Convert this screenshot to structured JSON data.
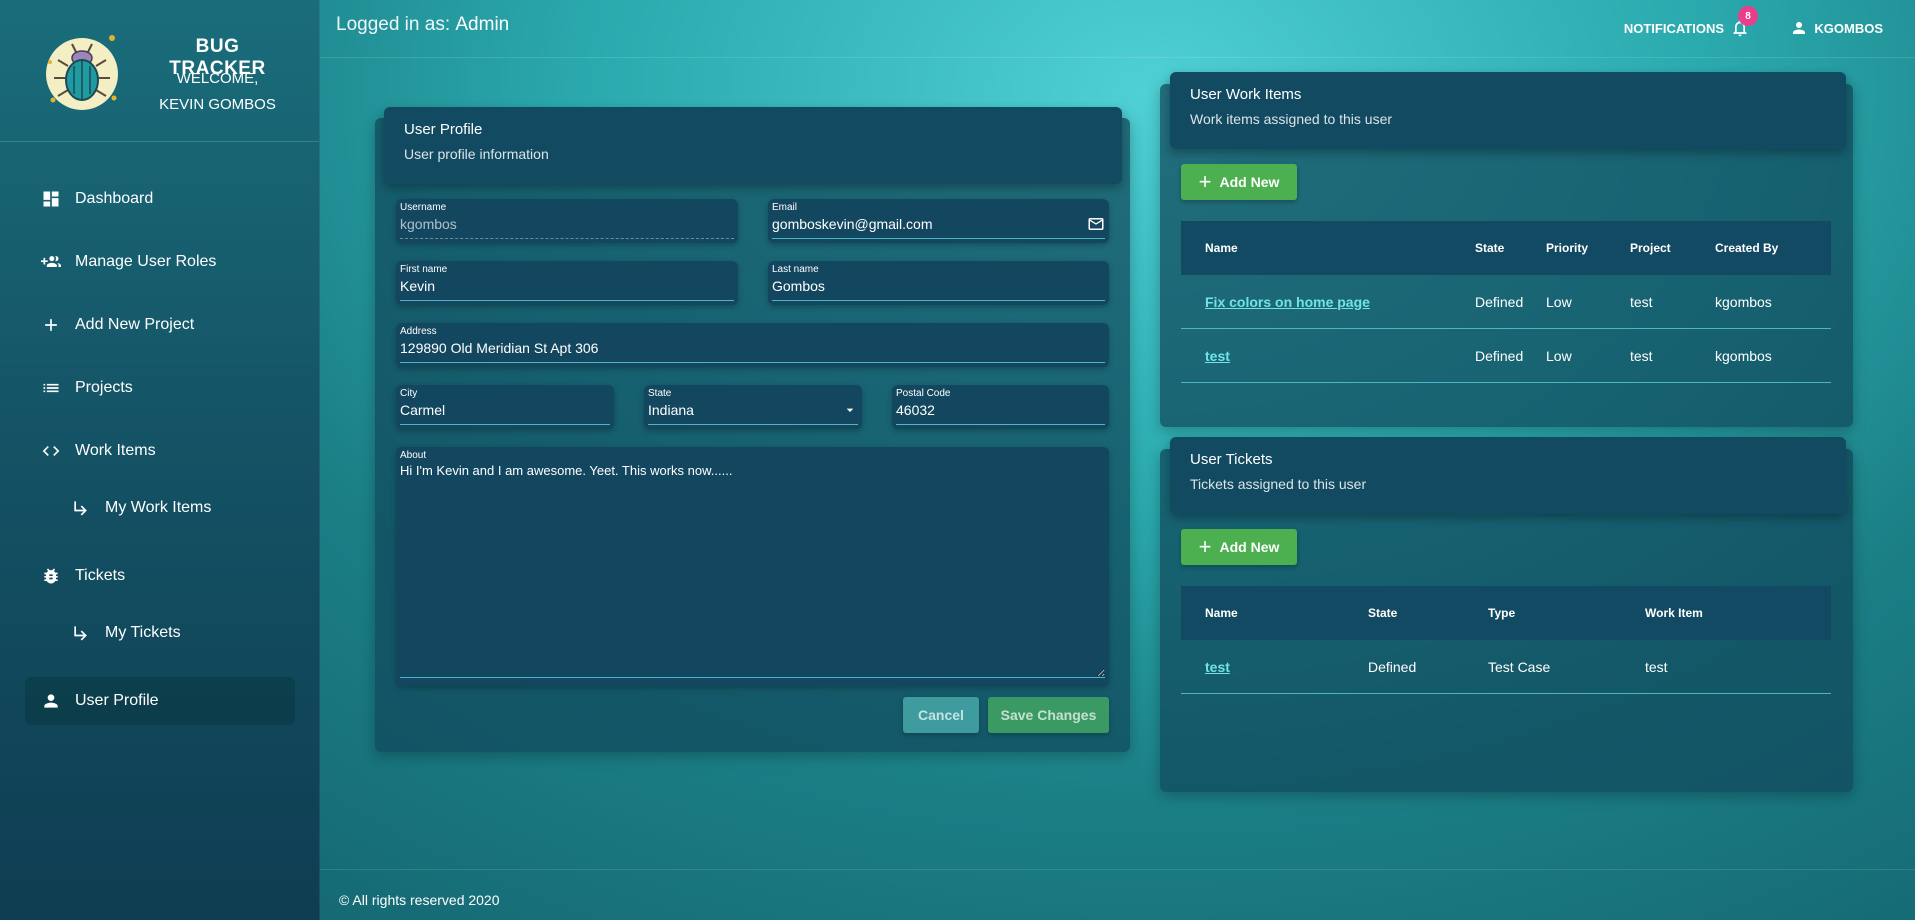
{
  "brand": {
    "title": "BUG TRACKER",
    "welcome_line1": "WELCOME,",
    "welcome_line2": "KEVIN GOMBOS"
  },
  "sidebar": {
    "items": [
      {
        "label": "Dashboard",
        "icon": "dashboard-icon"
      },
      {
        "label": "Manage User Roles",
        "icon": "group-add-icon"
      },
      {
        "label": "Add New Project",
        "icon": "plus-icon"
      },
      {
        "label": "Projects",
        "icon": "list-icon"
      },
      {
        "label": "Work Items",
        "icon": "code-icon"
      },
      {
        "label": "My Work Items",
        "icon": "subdirectory-arrow-icon"
      },
      {
        "label": "Tickets",
        "icon": "bug-icon"
      },
      {
        "label": "My Tickets",
        "icon": "subdirectory-arrow-icon"
      },
      {
        "label": "User Profile",
        "icon": "person-icon"
      }
    ]
  },
  "header": {
    "logged_prefix": "Logged in as:",
    "logged_role": "Admin",
    "notifications_label": "NOTIFICATIONS",
    "notifications_count": "8",
    "user_label": "KGOMBOS"
  },
  "profile": {
    "title": "User Profile",
    "subtitle": "User profile information",
    "username_label": "Username",
    "username_value": "kgombos",
    "email_label": "Email",
    "email_value": "gomboskevin@gmail.com",
    "first_label": "First name",
    "first_value": "Kevin",
    "last_label": "Last name",
    "last_value": "Gombos",
    "address_label": "Address",
    "address_value": "129890 Old Meridian St Apt 306",
    "city_label": "City",
    "city_value": "Carmel",
    "state_label": "State",
    "state_value": "Indiana",
    "postal_label": "Postal Code",
    "postal_value": "46032",
    "about_label": "About",
    "about_value": "Hi I'm Kevin and I am awesome. Yeet. This works now......",
    "cancel_label": "Cancel",
    "save_label": "Save Changes"
  },
  "work_items": {
    "title": "User Work Items",
    "subtitle": "Work items assigned to this user",
    "add_label": "Add New",
    "columns": [
      "Name",
      "State",
      "Priority",
      "Project",
      "Created By"
    ],
    "rows": [
      [
        "Fix colors on home page",
        "Defined",
        "Low",
        "test",
        "kgombos"
      ],
      [
        "test",
        "Defined",
        "Low",
        "test",
        "kgombos"
      ]
    ]
  },
  "tickets": {
    "title": "User Tickets",
    "subtitle": "Tickets assigned to this user",
    "add_label": "Add New",
    "columns": [
      "Name",
      "State",
      "Type",
      "Work Item"
    ],
    "rows": [
      [
        "test",
        "Defined",
        "Test Case",
        "test"
      ]
    ]
  },
  "footer": {
    "text": "© All rights reserved 2020"
  }
}
